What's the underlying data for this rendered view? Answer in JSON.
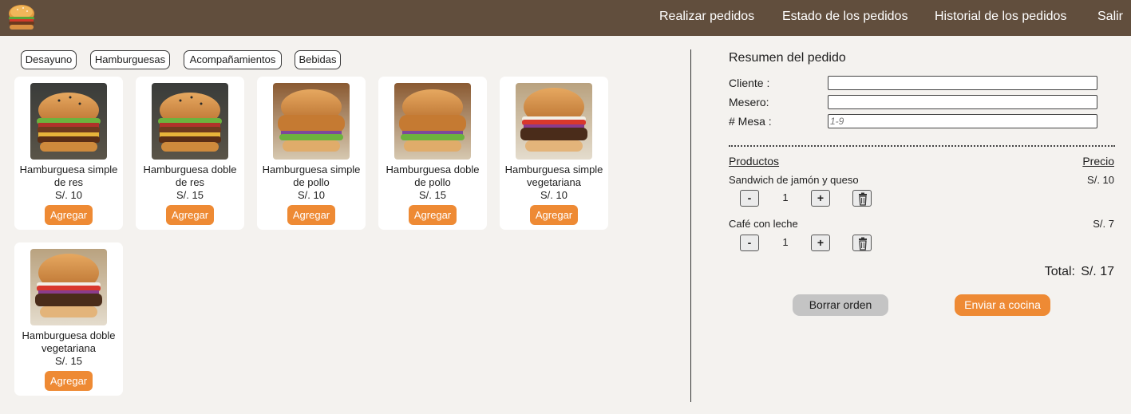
{
  "nav": {
    "logo_icon": "burger-logo-icon",
    "items": [
      "Realizar pedidos",
      "Estado de los pedidos",
      "Historial de los pedidos",
      "Salir"
    ]
  },
  "categories": [
    "Desayuno",
    "Hamburguesas",
    "Acompañamientos",
    "Bebidas"
  ],
  "products": [
    {
      "name": "Hamburguesa simple de res",
      "price": "S/. 10",
      "button": "Agregar",
      "image": "beef-burger-image"
    },
    {
      "name": "Hamburguesa doble de res",
      "price": "S/. 15",
      "button": "Agregar",
      "image": "beef-burger-image"
    },
    {
      "name": "Hamburguesa simple de pollo",
      "price": "S/. 10",
      "button": "Agregar",
      "image": "chicken-burger-image"
    },
    {
      "name": "Hamburguesa doble de pollo",
      "price": "S/. 15",
      "button": "Agregar",
      "image": "chicken-burger-image"
    },
    {
      "name": "Hamburguesa simple vegetariana",
      "price": "S/. 10",
      "button": "Agregar",
      "image": "veggie-burger-image"
    },
    {
      "name": "Hamburguesa doble vegetariana",
      "price": "S/. 15",
      "button": "Agregar",
      "image": "veggie-burger-image"
    }
  ],
  "summary": {
    "title": "Resumen del pedido",
    "fields": {
      "client": {
        "label": "Cliente :",
        "value": "",
        "placeholder": ""
      },
      "waiter": {
        "label": "Mesero:",
        "value": "",
        "placeholder": ""
      },
      "table": {
        "label": "# Mesa :",
        "value": "",
        "placeholder": "1-9"
      }
    },
    "col_products": "Productos",
    "col_price": "Precio",
    "items": [
      {
        "name": "Sandwich de jamón y queso",
        "price": "S/. 10",
        "qty": "1",
        "minus": "-",
        "plus": "+"
      },
      {
        "name": "Café con leche",
        "price": "S/. 7",
        "qty": "1",
        "minus": "-",
        "plus": "+"
      }
    ],
    "total_label": "Total:",
    "total_value": "S/. 17",
    "clear_button": "Borrar orden",
    "send_button": "Enviar a cocina"
  },
  "colors": {
    "header_bg": "#614e3d",
    "accent": "#ee8a34",
    "page_bg": "#f4f2ef"
  }
}
